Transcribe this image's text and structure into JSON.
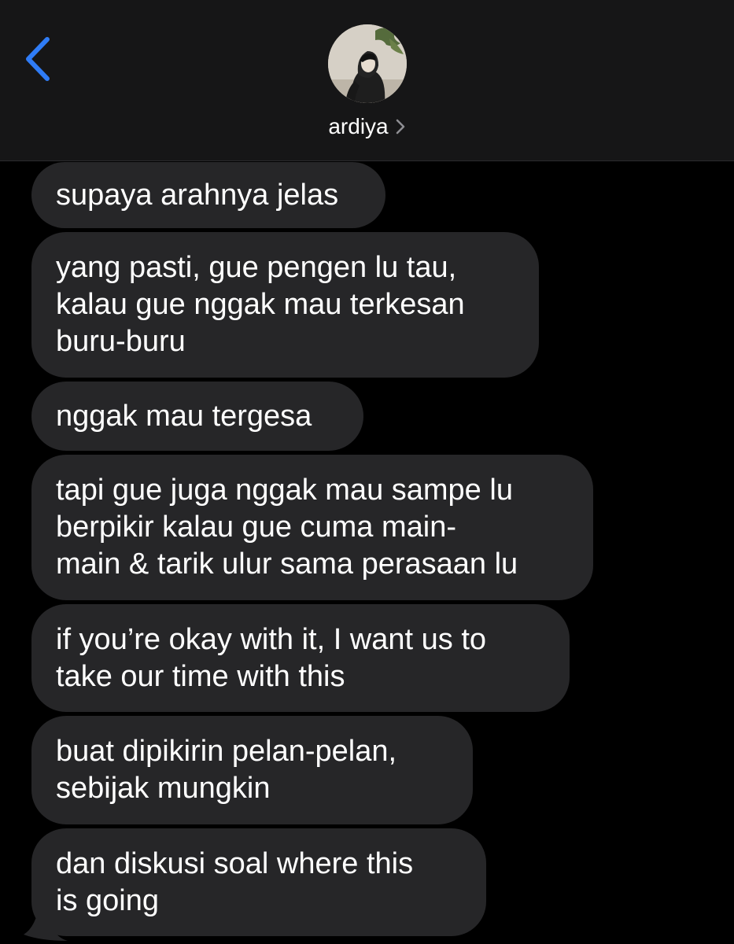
{
  "header": {
    "back_icon": "chevron-left-icon",
    "contact_name": "ardiya",
    "name_chevron_icon": "chevron-right-icon",
    "accent_color": "#2f7cf6"
  },
  "messages": [
    {
      "text": "supaya arahnya jelas"
    },
    {
      "text": "yang pasti, gue pengen lu tau,\nkalau gue nggak mau terkesan\nburu-buru"
    },
    {
      "text": "nggak mau tergesa"
    },
    {
      "text": "tapi gue juga nggak mau sampe lu\nberpikir kalau gue cuma main-\nmain & tarik ulur sama perasaan lu"
    },
    {
      "text": "if you’re okay with it, I want us to\ntake our time with this"
    },
    {
      "text": "buat dipikirin pelan-pelan,\nsebijak mungkin"
    },
    {
      "text": "dan diskusi soal where this\nis going"
    }
  ],
  "colors": {
    "header_bg": "#161617",
    "bubble_bg": "#262628",
    "background": "#000000"
  }
}
